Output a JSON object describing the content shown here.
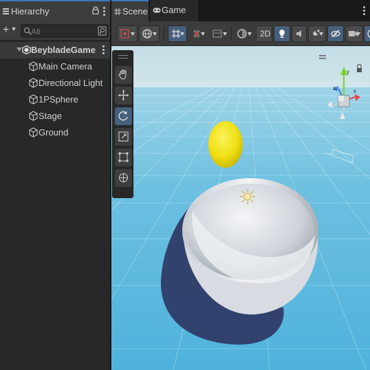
{
  "hierarchy": {
    "tab_label": "Hierarchy",
    "search": {
      "placeholder": "All"
    },
    "add_label": "+",
    "root": {
      "label": "BeybladeGame"
    },
    "children": [
      {
        "label": "Main Camera"
      },
      {
        "label": "Directional Light"
      },
      {
        "label": "1PSphere"
      },
      {
        "label": "Stage"
      },
      {
        "label": "Ground"
      }
    ]
  },
  "tabs": {
    "scene_label": "Scene",
    "game_label": "Game"
  },
  "scene_toolbar": {
    "mode_2d_label": "2D",
    "icons": [
      "draw-mode-icon",
      "global-icon",
      "grid-snap-icon",
      "snap-increment-icon",
      "render-mode-icon",
      "shading-icon",
      "lighting-icon",
      "audio-icon",
      "effects-icon",
      "hidden-objects-icon",
      "camera-icon",
      "gizmos-icon"
    ]
  },
  "tools": {
    "icons": [
      "view-tool-icon",
      "move-tool-icon",
      "rotate-tool-icon",
      "scale-tool-icon",
      "rect-tool-icon",
      "transform-tool-icon"
    ],
    "active": "rotate-tool-icon"
  },
  "gizmo": {
    "axes": [
      "x",
      "y",
      "z"
    ]
  },
  "colors": {
    "accent": "#3a79bb",
    "sky": "#7fc4dd",
    "ground": "#5fb8dc",
    "sphere": "#f1e21b",
    "bowl": "#e4e7ec"
  }
}
